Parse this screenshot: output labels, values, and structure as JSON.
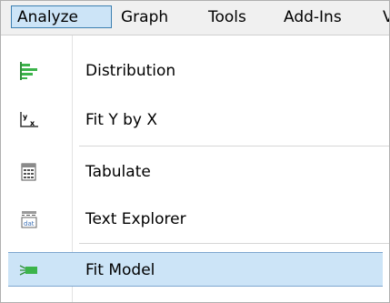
{
  "menubar": {
    "items": [
      {
        "label": "Analyze",
        "active": true
      },
      {
        "label": "Graph"
      },
      {
        "label": "Tools"
      },
      {
        "label": "Add-Ins"
      },
      {
        "label": "V"
      }
    ]
  },
  "menu": {
    "items": [
      {
        "label": "Distribution",
        "icon": "distribution-icon"
      },
      {
        "label": "Fit Y by X",
        "icon": "fit-y-by-x-icon"
      },
      {
        "label": "Tabulate",
        "icon": "tabulate-icon"
      },
      {
        "label": "Text Explorer",
        "icon": "text-explorer-icon"
      },
      {
        "label": "Fit Model",
        "icon": "fit-model-icon",
        "highlighted": true
      }
    ]
  },
  "colors": {
    "menubar_bg": "#f0f0f0",
    "active_bg": "#cce4f7",
    "active_border": "#3c7fb1",
    "icon_green": "#3cb44b"
  }
}
